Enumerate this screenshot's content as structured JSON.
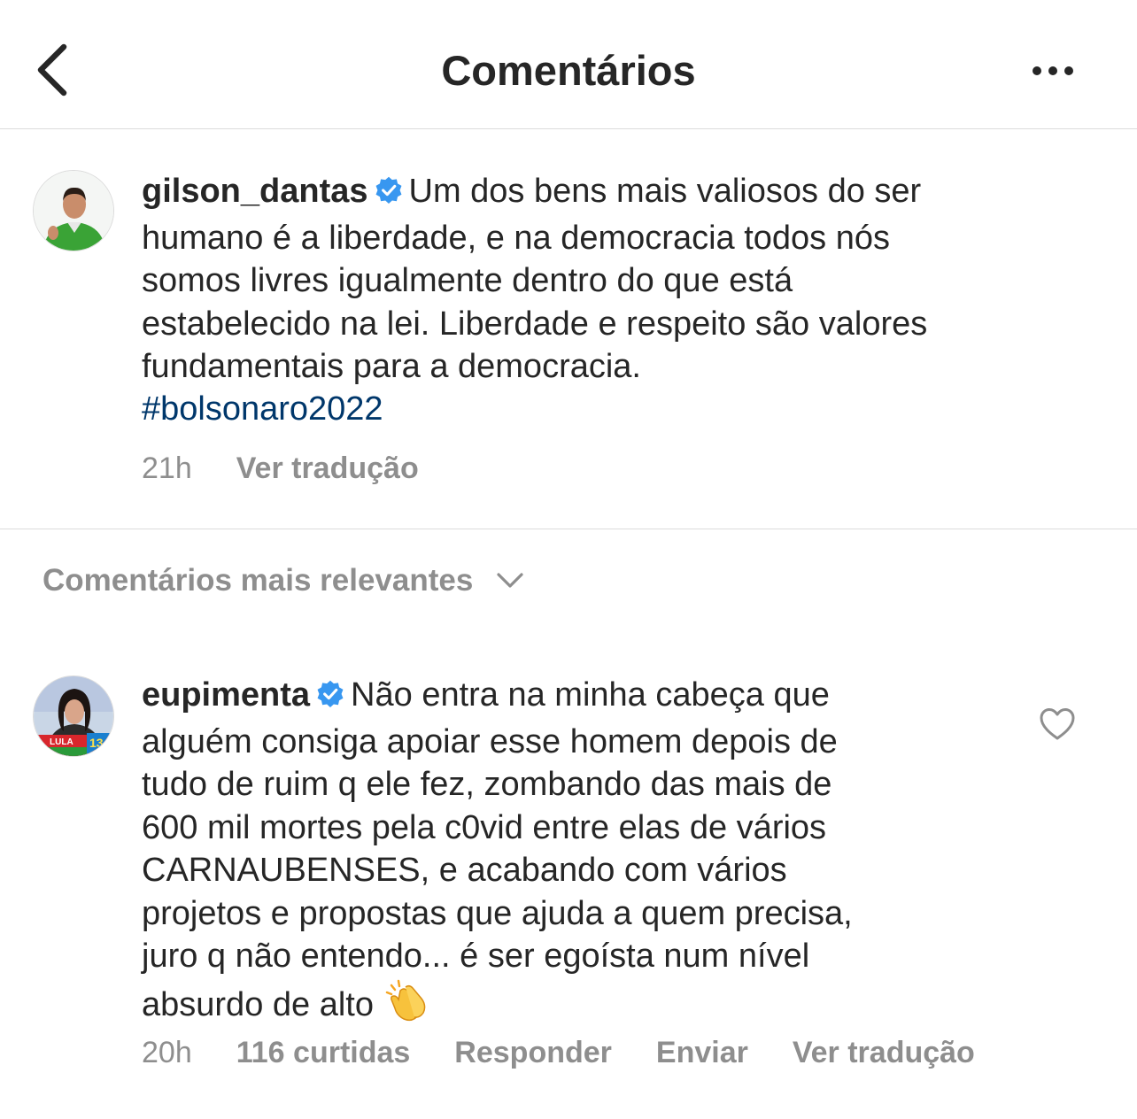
{
  "header": {
    "title": "Comentários",
    "back_icon": "chevron-left-icon",
    "more_icon": "more-horizontal-icon"
  },
  "caption": {
    "username": "gilson_dantas",
    "verified": true,
    "lines": [
      "Um dos bens mais valiosos do ser",
      "humano é a liberdade, e na democracia todos nós",
      "somos livres igualmente dentro do que está",
      "estabelecido na lei. Liberdade e respeito são valores",
      "fundamentais para a democracia."
    ],
    "hashtag": "#bolsonaro2022",
    "time": "21h",
    "translate": "Ver tradução"
  },
  "sort": {
    "label": "Comentários mais relevantes",
    "icon": "chevron-down-icon"
  },
  "comments": [
    {
      "username": "eupimenta",
      "verified": true,
      "lines": [
        "Não entra na minha cabeça que",
        "alguém consiga apoiar esse homem depois de",
        "tudo de ruim q ele fez, zombando das mais de",
        "600 mil mortes pela c0vid entre elas de vários",
        "CARNAUBENSES, e acabando com vários",
        "projetos e propostas que ajuda a quem precisa,",
        "juro q não entendo... é ser egoísta num nível",
        "absurdo de alto"
      ],
      "emoji": "clapping-hands-emoji",
      "time": "20h",
      "likes": "116 curtidas",
      "reply": "Responder",
      "send": "Enviar",
      "translate": "Ver tradução",
      "avatar_badge": "LULA",
      "avatar_badge_number": "13"
    }
  ],
  "colors": {
    "text": "#262626",
    "secondary": "#8e8e8e",
    "hashtag": "#00376b",
    "verified": "#3897f0",
    "divider": "#dbdbdb"
  }
}
